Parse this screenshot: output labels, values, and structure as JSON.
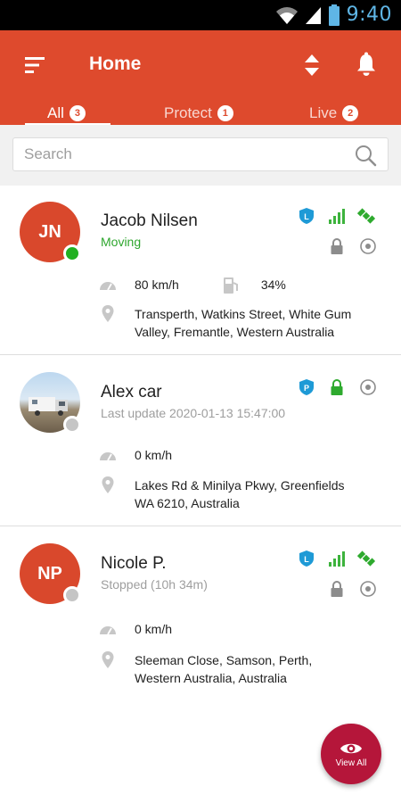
{
  "status_bar": {
    "time": "9:40",
    "icons": [
      "wifi-icon",
      "signal-icon",
      "battery-icon"
    ]
  },
  "header": {
    "title": "Home",
    "color": "#de4a2d"
  },
  "tabs": [
    {
      "label": "All",
      "badge": "3",
      "active": true
    },
    {
      "label": "Protect",
      "badge": "1",
      "active": false
    },
    {
      "label": "Live",
      "badge": "2",
      "active": false
    }
  ],
  "search": {
    "placeholder": "Search"
  },
  "vehicles": [
    {
      "initials": "JN",
      "name": "Jacob Nilsen",
      "status": "Moving",
      "speed": "80 km/h",
      "fuel": "34%",
      "address": [
        "Transperth, Watkins Street, White Gum",
        "Valley, Fremantle, Western Australia"
      ],
      "icons": [
        "shield-icon",
        "signal-bars-icon",
        "satellite-icon",
        "lock-icon",
        "target-icon"
      ]
    },
    {
      "initials": "",
      "name": "Alex car",
      "status": "Last update 2020-01-13 15:47:00",
      "speed": "0 km/h",
      "address": [
        "Lakes Rd & Minilya Pkwy, Greenfields",
        "WA 6210, Australia"
      ],
      "icons": [
        "parking-shield-icon",
        "lock-icon",
        "target-icon"
      ]
    },
    {
      "initials": "NP",
      "name": "Nicole P.",
      "status": "Stopped (10h 34m)",
      "speed": "0 km/h",
      "address": [
        "Sleeman Close, Samson, Perth,",
        "Western Australia, Australia"
      ],
      "icons": [
        "shield-icon",
        "signal-bars-icon",
        "satellite-icon",
        "lock-icon",
        "target-icon"
      ]
    }
  ],
  "fab": {
    "label": "View All"
  }
}
